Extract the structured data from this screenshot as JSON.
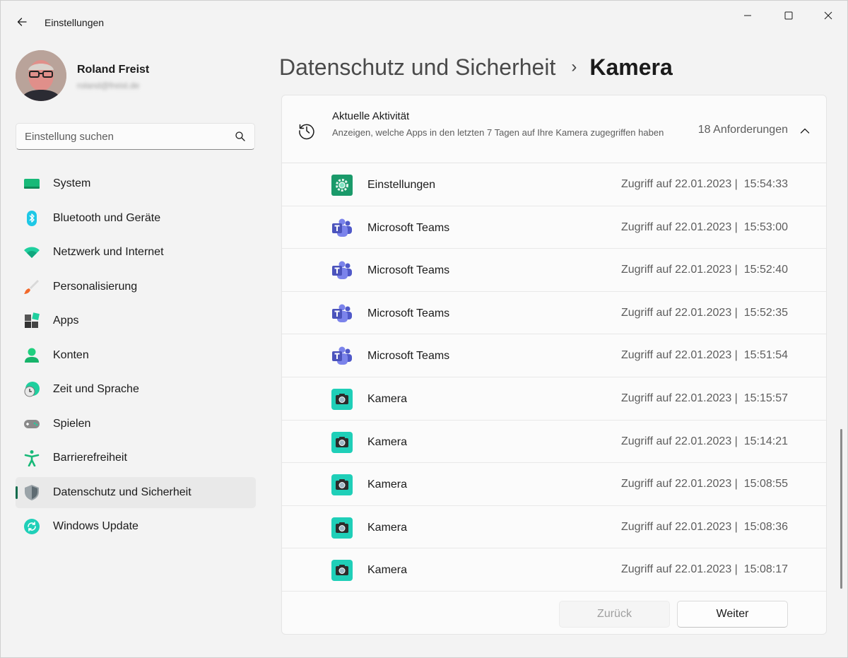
{
  "window": {
    "app_title": "Einstellungen"
  },
  "profile": {
    "name": "Roland Freist",
    "email": "roland@freist.de"
  },
  "search": {
    "placeholder": "Einstellung suchen"
  },
  "sidebar": {
    "items": [
      {
        "label": "System",
        "icon": "system-icon"
      },
      {
        "label": "Bluetooth und Geräte",
        "icon": "bluetooth-icon"
      },
      {
        "label": "Netzwerk und Internet",
        "icon": "wifi-icon"
      },
      {
        "label": "Personalisierung",
        "icon": "brush-icon"
      },
      {
        "label": "Apps",
        "icon": "apps-icon"
      },
      {
        "label": "Konten",
        "icon": "account-icon"
      },
      {
        "label": "Zeit und Sprache",
        "icon": "clock-globe-icon"
      },
      {
        "label": "Spielen",
        "icon": "gamepad-icon"
      },
      {
        "label": "Barrierefreiheit",
        "icon": "accessibility-icon"
      },
      {
        "label": "Datenschutz und Sicherheit",
        "icon": "shield-icon",
        "active": true
      },
      {
        "label": "Windows Update",
        "icon": "update-icon"
      }
    ]
  },
  "breadcrumb": {
    "parent": "Datenschutz und Sicherheit",
    "separator": "›",
    "current": "Kamera"
  },
  "activity": {
    "title": "Aktuelle Aktivität",
    "description": "Anzeigen, welche Apps in den letzten 7 Tagen auf Ihre Kamera zugegriffen haben",
    "count": "18 Anforderungen",
    "rows": [
      {
        "app": "Einstellungen",
        "icon": "settings-gear-icon",
        "access": "Zugriff auf 22.01.2023 |  15:54:33"
      },
      {
        "app": "Microsoft Teams",
        "icon": "teams-icon",
        "access": "Zugriff auf 22.01.2023 |  15:53:00"
      },
      {
        "app": "Microsoft Teams",
        "icon": "teams-icon",
        "access": "Zugriff auf 22.01.2023 |  15:52:40"
      },
      {
        "app": "Microsoft Teams",
        "icon": "teams-icon",
        "access": "Zugriff auf 22.01.2023 |  15:52:35"
      },
      {
        "app": "Microsoft Teams",
        "icon": "teams-icon",
        "access": "Zugriff auf 22.01.2023 |  15:51:54"
      },
      {
        "app": "Kamera",
        "icon": "camera-icon",
        "access": "Zugriff auf 22.01.2023 |  15:15:57"
      },
      {
        "app": "Kamera",
        "icon": "camera-icon",
        "access": "Zugriff auf 22.01.2023 |  15:14:21"
      },
      {
        "app": "Kamera",
        "icon": "camera-icon",
        "access": "Zugriff auf 22.01.2023 |  15:08:55"
      },
      {
        "app": "Kamera",
        "icon": "camera-icon",
        "access": "Zugriff auf 22.01.2023 |  15:08:36"
      },
      {
        "app": "Kamera",
        "icon": "camera-icon",
        "access": "Zugriff auf 22.01.2023 |  15:08:17"
      }
    ]
  },
  "pagination": {
    "back_label": "Zurück",
    "next_label": "Weiter"
  },
  "colors": {
    "accent": "#0f6b4c",
    "teams": "#4b53bc",
    "camera": "#1fcfb8"
  }
}
